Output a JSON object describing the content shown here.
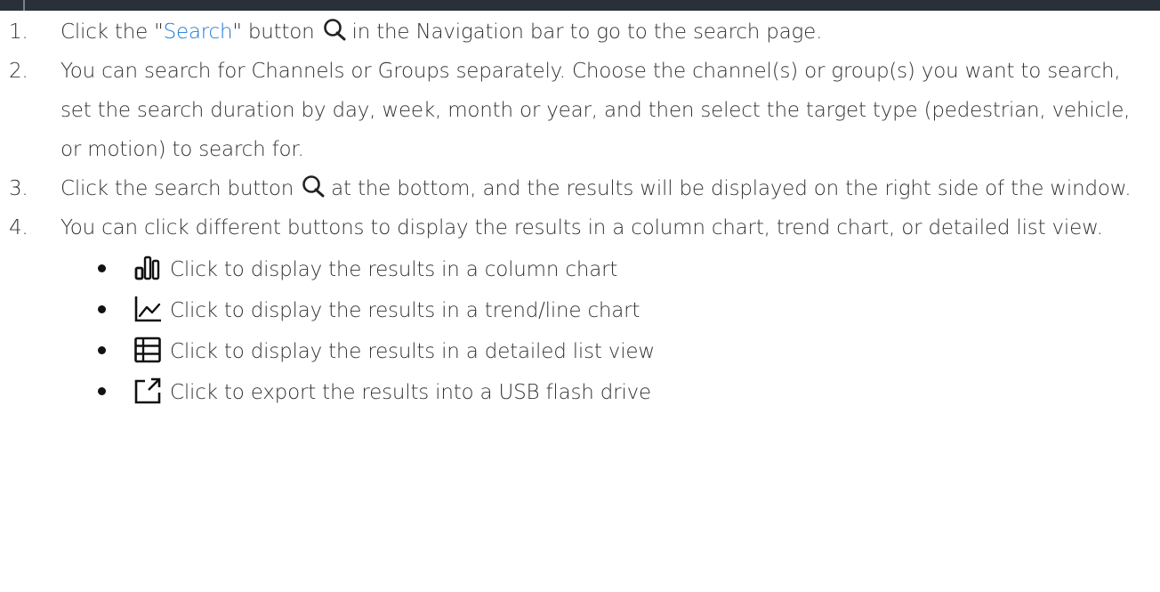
{
  "steps": [
    {
      "num": "1.",
      "before": "Click the \"",
      "link": "Search",
      "after_link": "\" button",
      "icon": "search-icon",
      "rest": "in the Navigation bar to go to the search page."
    },
    {
      "num": "2.",
      "text": "You can search for Channels or Groups separately. Choose the channel(s) or group(s) you want to search, set the search duration by day, week, month or year, and then select the target type (pedestrian, vehicle, or motion) to search for."
    },
    {
      "num": "3.",
      "before": "Click the search button",
      "icon": "search-icon",
      "rest": "at the bottom, and the results will be displayed on the right side of the window."
    },
    {
      "num": "4.",
      "text": "You can click different buttons to display the results in a column chart, trend chart, or detailed list view."
    }
  ],
  "bullets": [
    {
      "icon": "column-chart-icon",
      "text": "Click to display the results in a column chart"
    },
    {
      "icon": "line-chart-icon",
      "text": "Click to display the results in a trend/line chart"
    },
    {
      "icon": "list-view-icon",
      "text": "Click to display the results in a detailed list view"
    },
    {
      "icon": "export-icon",
      "text": "Click to export the results into a USB flash drive"
    }
  ],
  "colors": {
    "link": "#1e78d7",
    "text": "#333333",
    "top_bar": "#2a3038"
  }
}
